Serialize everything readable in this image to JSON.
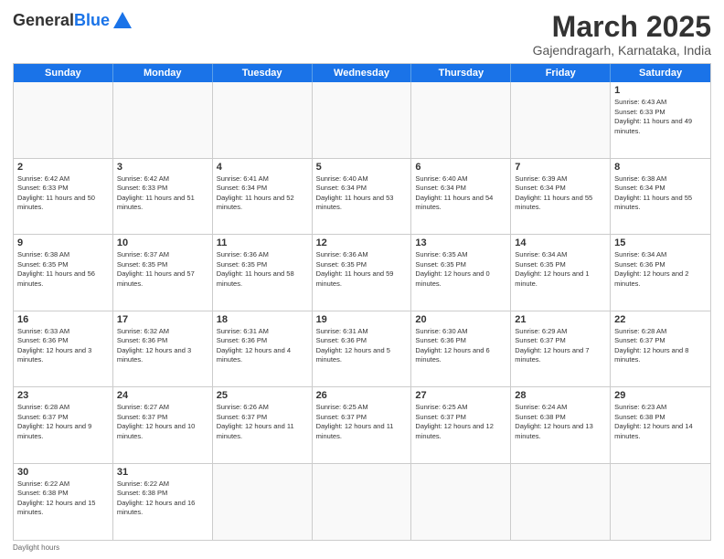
{
  "header": {
    "logo_general": "General",
    "logo_blue": "Blue",
    "month_title": "March 2025",
    "subtitle": "Gajendragarh, Karnataka, India"
  },
  "day_headers": [
    "Sunday",
    "Monday",
    "Tuesday",
    "Wednesday",
    "Thursday",
    "Friday",
    "Saturday"
  ],
  "weeks": [
    [
      {
        "day": "",
        "empty": true
      },
      {
        "day": "",
        "empty": true
      },
      {
        "day": "",
        "empty": true
      },
      {
        "day": "",
        "empty": true
      },
      {
        "day": "",
        "empty": true
      },
      {
        "day": "",
        "empty": true
      },
      {
        "day": "1",
        "sunrise": "Sunrise: 6:43 AM",
        "sunset": "Sunset: 6:33 PM",
        "daylight": "Daylight: 11 hours and 49 minutes."
      }
    ],
    [
      {
        "day": "2",
        "sunrise": "Sunrise: 6:42 AM",
        "sunset": "Sunset: 6:33 PM",
        "daylight": "Daylight: 11 hours and 50 minutes."
      },
      {
        "day": "3",
        "sunrise": "Sunrise: 6:42 AM",
        "sunset": "Sunset: 6:33 PM",
        "daylight": "Daylight: 11 hours and 51 minutes."
      },
      {
        "day": "4",
        "sunrise": "Sunrise: 6:41 AM",
        "sunset": "Sunset: 6:34 PM",
        "daylight": "Daylight: 11 hours and 52 minutes."
      },
      {
        "day": "5",
        "sunrise": "Sunrise: 6:40 AM",
        "sunset": "Sunset: 6:34 PM",
        "daylight": "Daylight: 11 hours and 53 minutes."
      },
      {
        "day": "6",
        "sunrise": "Sunrise: 6:40 AM",
        "sunset": "Sunset: 6:34 PM",
        "daylight": "Daylight: 11 hours and 54 minutes."
      },
      {
        "day": "7",
        "sunrise": "Sunrise: 6:39 AM",
        "sunset": "Sunset: 6:34 PM",
        "daylight": "Daylight: 11 hours and 55 minutes."
      },
      {
        "day": "8",
        "sunrise": "Sunrise: 6:38 AM",
        "sunset": "Sunset: 6:34 PM",
        "daylight": "Daylight: 11 hours and 55 minutes."
      }
    ],
    [
      {
        "day": "9",
        "sunrise": "Sunrise: 6:38 AM",
        "sunset": "Sunset: 6:35 PM",
        "daylight": "Daylight: 11 hours and 56 minutes."
      },
      {
        "day": "10",
        "sunrise": "Sunrise: 6:37 AM",
        "sunset": "Sunset: 6:35 PM",
        "daylight": "Daylight: 11 hours and 57 minutes."
      },
      {
        "day": "11",
        "sunrise": "Sunrise: 6:36 AM",
        "sunset": "Sunset: 6:35 PM",
        "daylight": "Daylight: 11 hours and 58 minutes."
      },
      {
        "day": "12",
        "sunrise": "Sunrise: 6:36 AM",
        "sunset": "Sunset: 6:35 PM",
        "daylight": "Daylight: 11 hours and 59 minutes."
      },
      {
        "day": "13",
        "sunrise": "Sunrise: 6:35 AM",
        "sunset": "Sunset: 6:35 PM",
        "daylight": "Daylight: 12 hours and 0 minutes."
      },
      {
        "day": "14",
        "sunrise": "Sunrise: 6:34 AM",
        "sunset": "Sunset: 6:35 PM",
        "daylight": "Daylight: 12 hours and 1 minute."
      },
      {
        "day": "15",
        "sunrise": "Sunrise: 6:34 AM",
        "sunset": "Sunset: 6:36 PM",
        "daylight": "Daylight: 12 hours and 2 minutes."
      }
    ],
    [
      {
        "day": "16",
        "sunrise": "Sunrise: 6:33 AM",
        "sunset": "Sunset: 6:36 PM",
        "daylight": "Daylight: 12 hours and 3 minutes."
      },
      {
        "day": "17",
        "sunrise": "Sunrise: 6:32 AM",
        "sunset": "Sunset: 6:36 PM",
        "daylight": "Daylight: 12 hours and 3 minutes."
      },
      {
        "day": "18",
        "sunrise": "Sunrise: 6:31 AM",
        "sunset": "Sunset: 6:36 PM",
        "daylight": "Daylight: 12 hours and 4 minutes."
      },
      {
        "day": "19",
        "sunrise": "Sunrise: 6:31 AM",
        "sunset": "Sunset: 6:36 PM",
        "daylight": "Daylight: 12 hours and 5 minutes."
      },
      {
        "day": "20",
        "sunrise": "Sunrise: 6:30 AM",
        "sunset": "Sunset: 6:36 PM",
        "daylight": "Daylight: 12 hours and 6 minutes."
      },
      {
        "day": "21",
        "sunrise": "Sunrise: 6:29 AM",
        "sunset": "Sunset: 6:37 PM",
        "daylight": "Daylight: 12 hours and 7 minutes."
      },
      {
        "day": "22",
        "sunrise": "Sunrise: 6:28 AM",
        "sunset": "Sunset: 6:37 PM",
        "daylight": "Daylight: 12 hours and 8 minutes."
      }
    ],
    [
      {
        "day": "23",
        "sunrise": "Sunrise: 6:28 AM",
        "sunset": "Sunset: 6:37 PM",
        "daylight": "Daylight: 12 hours and 9 minutes."
      },
      {
        "day": "24",
        "sunrise": "Sunrise: 6:27 AM",
        "sunset": "Sunset: 6:37 PM",
        "daylight": "Daylight: 12 hours and 10 minutes."
      },
      {
        "day": "25",
        "sunrise": "Sunrise: 6:26 AM",
        "sunset": "Sunset: 6:37 PM",
        "daylight": "Daylight: 12 hours and 11 minutes."
      },
      {
        "day": "26",
        "sunrise": "Sunrise: 6:25 AM",
        "sunset": "Sunset: 6:37 PM",
        "daylight": "Daylight: 12 hours and 11 minutes."
      },
      {
        "day": "27",
        "sunrise": "Sunrise: 6:25 AM",
        "sunset": "Sunset: 6:37 PM",
        "daylight": "Daylight: 12 hours and 12 minutes."
      },
      {
        "day": "28",
        "sunrise": "Sunrise: 6:24 AM",
        "sunset": "Sunset: 6:38 PM",
        "daylight": "Daylight: 12 hours and 13 minutes."
      },
      {
        "day": "29",
        "sunrise": "Sunrise: 6:23 AM",
        "sunset": "Sunset: 6:38 PM",
        "daylight": "Daylight: 12 hours and 14 minutes."
      }
    ],
    [
      {
        "day": "30",
        "sunrise": "Sunrise: 6:22 AM",
        "sunset": "Sunset: 6:38 PM",
        "daylight": "Daylight: 12 hours and 15 minutes."
      },
      {
        "day": "31",
        "sunrise": "Sunrise: 6:22 AM",
        "sunset": "Sunset: 6:38 PM",
        "daylight": "Daylight: 12 hours and 16 minutes."
      },
      {
        "day": "",
        "empty": true
      },
      {
        "day": "",
        "empty": true
      },
      {
        "day": "",
        "empty": true
      },
      {
        "day": "",
        "empty": true
      },
      {
        "day": "",
        "empty": true
      }
    ]
  ],
  "footer": {
    "daylight_label": "Daylight hours"
  }
}
